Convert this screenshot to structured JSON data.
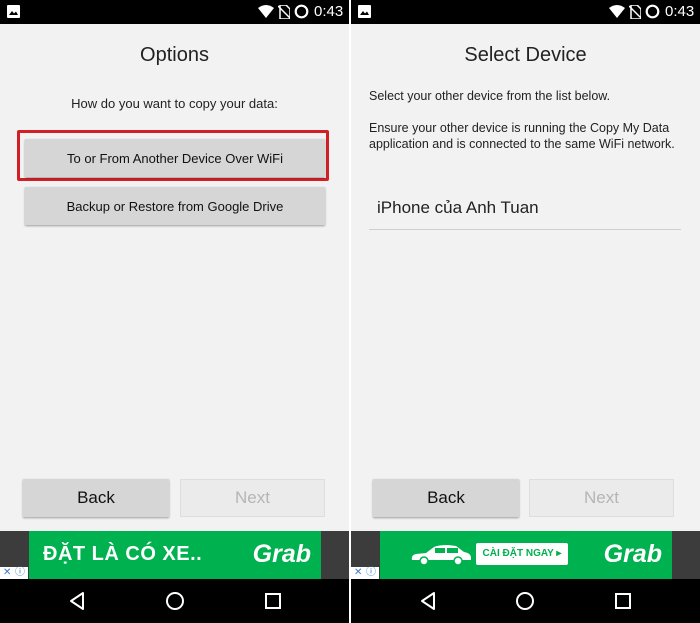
{
  "status_bar": {
    "time": "0:43"
  },
  "options_screen": {
    "title": "Options",
    "prompt": "How do you want to copy your data:",
    "option_wifi": "To or From Another Device Over WiFi",
    "option_drive": "Backup or Restore from Google Drive",
    "back": "Back",
    "next": "Next"
  },
  "select_screen": {
    "title": "Select Device",
    "instruction": "Select your other device from the list below.",
    "requirement": "Ensure your other device is running the Copy My Data application and is connected to the same WiFi network.",
    "devices": [
      "iPhone của Anh Tuan"
    ],
    "back": "Back",
    "next": "Next"
  },
  "ads": {
    "left_text": "ĐẶT LÀ CÓ XE..",
    "brand": "Grab",
    "right_button": "CÀI ĐẶT NGAY ▸",
    "colors": {
      "brand_green": "#00b14f"
    }
  },
  "colors": {
    "highlight": "#d21f26",
    "button": "#d6d6d6"
  }
}
